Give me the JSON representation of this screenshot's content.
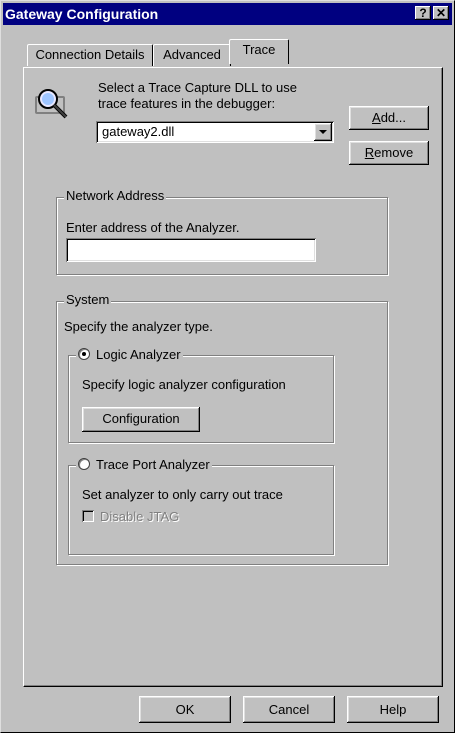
{
  "window": {
    "title": "Gateway Configuration",
    "help_glyph": "?",
    "close_glyph": "✕"
  },
  "tabs": [
    {
      "label": "Connection Details",
      "active": false
    },
    {
      "label": "Advanced",
      "active": false
    },
    {
      "label": "Trace",
      "active": true
    }
  ],
  "trace": {
    "icon": "search-trace-icon",
    "description_line1": "Select a Trace Capture DLL to use",
    "description_line2": "trace features in the debugger:",
    "dll_selected": "gateway2.dll",
    "add_button": {
      "accel": "A",
      "rest": "dd..."
    },
    "remove_button": {
      "accel": "R",
      "rest": "emove"
    }
  },
  "network_address": {
    "legend": "Network Address",
    "prompt": "Enter address of the Analyzer.",
    "value": ""
  },
  "system": {
    "legend": "System",
    "prompt": "Specify the analyzer type.",
    "logic": {
      "label": "Logic Analyzer",
      "selected": true,
      "description": "Specify  logic analyzer configuration",
      "config_button": "Configuration"
    },
    "trace_port": {
      "label": "Trace Port Analyzer",
      "selected": false,
      "description": "Set analyzer to only carry out trace",
      "disable_jtag_label": "Disable JTAG",
      "disable_jtag_checked": false,
      "disable_jtag_enabled": false
    }
  },
  "footer": {
    "ok": "OK",
    "cancel": "Cancel",
    "help": "Help"
  }
}
